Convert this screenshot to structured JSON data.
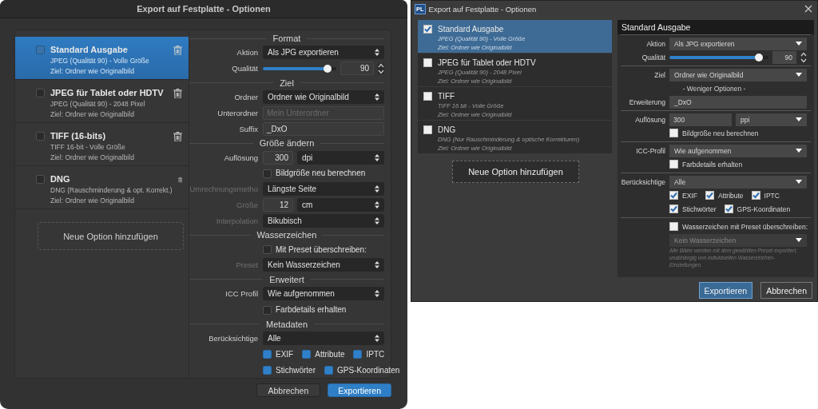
{
  "mac_dialog": {
    "title": "Export auf Festplatte - Optionen",
    "presets": [
      {
        "name": "Standard Ausgabe",
        "description": "JPEG (Qualität 90) - Volle Größe",
        "destination": "Ziel: Ordner wie Originalbild",
        "checked": false,
        "selected": true
      },
      {
        "name": "JPEG für Tablet oder HDTV",
        "description": "JPEG (Qualität 90) - 2048 Pixel",
        "destination": "Ziel: Ordner wie Originalbild",
        "checked": false,
        "selected": false
      },
      {
        "name": "TIFF (16-bits)",
        "description": "TIFF 16-bit - Volle Größe",
        "destination": "Ziel: Ordner wie Originalbild",
        "checked": false,
        "selected": false
      },
      {
        "name": "DNG",
        "description": "DNG (Rauschminderung & opt. Korrekt.)",
        "destination": "Ziel: Ordner wie Originalbild",
        "checked": false,
        "selected": false
      }
    ],
    "add_button": "Neue Option hinzufügen",
    "rows": [
      {
        "kind": "heading",
        "label": "Format"
      },
      {
        "kind": "select",
        "label": "Aktion",
        "value": "Als JPG exportieren",
        "disabled": false
      },
      {
        "kind": "slider",
        "label": "Qualität",
        "level": 0.88,
        "value": "90"
      },
      {
        "kind": "heading",
        "label": "Ziel"
      },
      {
        "kind": "select",
        "label": "Ordner",
        "value": "Ordner wie Originalbild",
        "disabled": false
      },
      {
        "kind": "field",
        "label": "Unterordner",
        "placeholder": "Mein Unterordner",
        "disabled": false
      },
      {
        "kind": "field",
        "label": "Suffix",
        "value": "_DxO",
        "disabled": false
      },
      {
        "kind": "heading",
        "label": "Größe ändern"
      },
      {
        "kind": "size",
        "label": "Auflösung",
        "value": "300",
        "unit": "dpi",
        "disabled": false
      },
      {
        "kind": "checkbox",
        "label": "Bildgröße neu berechnen",
        "checked": false
      },
      {
        "kind": "select",
        "label": "Umrechnungsmetho",
        "value": "Längste Seite",
        "disabled": true
      },
      {
        "kind": "size",
        "label": "Größe",
        "value": "12",
        "unit": "cm",
        "disabled": true
      },
      {
        "kind": "select",
        "label": "Interpolation",
        "value": "Bikubisch",
        "disabled": true
      },
      {
        "kind": "heading",
        "label": "Wasserzeichen"
      },
      {
        "kind": "checkbox",
        "label": "Mit Preset überschreiben:",
        "checked": false
      },
      {
        "kind": "select",
        "label": "Preset",
        "value": "Kein Wasserzeichen",
        "disabled": true
      },
      {
        "kind": "heading",
        "label": "Erweitert"
      },
      {
        "kind": "select",
        "label": "ICC Profil",
        "value": "Wie aufgenommen",
        "disabled": false
      },
      {
        "kind": "checkbox",
        "label": "Farbdetails erhalten",
        "checked": false
      },
      {
        "kind": "heading",
        "label": "Metadaten"
      },
      {
        "kind": "select",
        "label": "Berücksichtige",
        "value": "Alle",
        "disabled": false
      },
      {
        "kind": "checks",
        "items": [
          {
            "label": "EXIF",
            "checked": true
          },
          {
            "label": "Attribute",
            "checked": true
          },
          {
            "label": "IPTC",
            "checked": true
          }
        ]
      },
      {
        "kind": "checks",
        "items": [
          {
            "label": "Stichwörter",
            "checked": true
          },
          {
            "label": "GPS-Koordinaten",
            "checked": true
          }
        ]
      }
    ],
    "buttons": [
      {
        "label": "Abbrechen",
        "primary": false
      },
      {
        "label": "Exportieren",
        "primary": true
      }
    ]
  },
  "windows_dialog": {
    "icon_label": "PL",
    "title": "Export auf Festplatte - Optionen",
    "presets": [
      {
        "name": "Standard Ausgabe",
        "description": "JPEG (Qualität 90) - Volle Größe",
        "destination": "Ziel: Ordner wie Originalbild",
        "checked": true,
        "selected": true
      },
      {
        "name": "JPEG für Tablet oder HDTV",
        "description": "JPEG (Qualität 90) - 2048 Pixel",
        "destination": "Ziel: Ordner wie Originalbild",
        "checked": false,
        "selected": false
      },
      {
        "name": "TIFF",
        "description": "TIFF 16 bit - Volle Größe",
        "destination": "Ziel: Ordner wie Originalbild",
        "checked": false,
        "selected": false
      },
      {
        "name": "DNG",
        "description": "DNG (Nur Rauschminderung & optische Korrekturen)",
        "destination": "Ziel: Ordner wie Originalbild",
        "checked": false,
        "selected": false
      }
    ],
    "add_button": "Neue Option hinzufügen",
    "panel_title": "Standard Ausgabe",
    "groups": [
      [
        {
          "kind": "select",
          "label": "Aktion",
          "value": "Als JPG exportieren",
          "disabled": false
        },
        {
          "kind": "slider",
          "label": "Qualität",
          "level": 0.9,
          "value": "90"
        }
      ],
      [
        {
          "kind": "select",
          "label": "Ziel",
          "value": "Ordner wie Originalbild",
          "disabled": false
        },
        {
          "kind": "link",
          "label": "- Weniger Optionen -"
        },
        {
          "kind": "field",
          "label": "Erweiterung",
          "value": "_DxO",
          "disabled": false
        }
      ],
      [
        {
          "kind": "size",
          "label": "Auflösung",
          "value": "300",
          "unit": "ppi",
          "disabled": false
        },
        {
          "kind": "checkbox",
          "label": "Bildgröße neu berechnen",
          "checked": false
        }
      ],
      [
        {
          "kind": "select",
          "label": "ICC-Profil",
          "value": "Wie aufgenommen",
          "disabled": false
        },
        {
          "kind": "checkbox",
          "label": "Farbdetails erhalten",
          "checked": false
        }
      ],
      [
        {
          "kind": "select",
          "label": "Berücksichtige",
          "value": "Alle",
          "disabled": false
        },
        {
          "kind": "checks",
          "items": [
            {
              "label": "EXIF",
              "checked": true
            },
            {
              "label": "Attribute",
              "checked": true
            },
            {
              "label": "IPTC",
              "checked": true
            }
          ]
        },
        {
          "kind": "checks",
          "items": [
            {
              "label": "Stichwörter",
              "checked": true
            },
            {
              "label": "GPS-Koordinaten",
              "checked": true
            }
          ]
        }
      ],
      [
        {
          "kind": "checkbox",
          "label": "Wasserzeichen mit Preset überschreiben:",
          "checked": false
        },
        {
          "kind": "select",
          "value": "Kein Wasserzeichen",
          "disabled": true
        },
        {
          "kind": "note",
          "text": "Alle Bilder werden mit dem gewählten Preset exportiert, unabhängig von individuellen Wasserzeichen-Einstellungen."
        }
      ]
    ],
    "buttons": [
      {
        "label": "Exportieren",
        "primary": true
      },
      {
        "label": "Abbrechen",
        "primary": false
      }
    ]
  }
}
